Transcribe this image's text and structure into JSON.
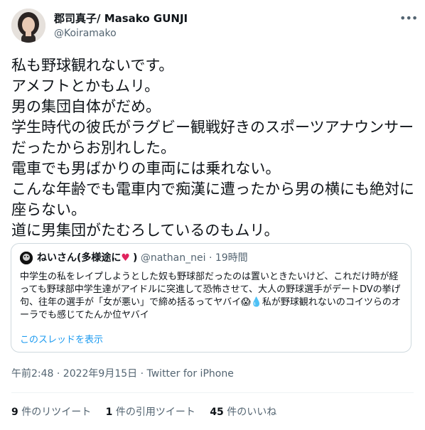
{
  "author": {
    "name": "郡司真子/ Masako GUNJI",
    "handle": "@Koiramako"
  },
  "tweet": {
    "text": "私も野球観れないです。\nアメフトとかもムリ。\n男の集団自体がだめ。\n学生時代の彼氏がラグビー観戦好きのスポーツアナウンサーだったからお別れした。\n電車でも男ばかりの車両には乗れない。\nこんな年齢でも電車内で痴漢に遭ったから男の横にも絶対に座らない。\n道に男集団がたむろしているのもムリ。"
  },
  "quote": {
    "name": "ねいさん(多様途に",
    "heart": "♥",
    "name_suffix": ")",
    "handle": "@nathan_nei",
    "time": "19時間",
    "text": "中学生の私をレイプしようとした奴も野球部だったのは置いときたいけど、これだけ時が経っても野球部中学生達がアイドルに突進して恐怖させて、大人の野球選手がデートDVの挙げ句、往年の選手が「女が悪い」で締め括るってヤバイ😱💧私が野球観れないのコイツらのオーラでも感じてたんか位ヤバイ",
    "thread_link": "このスレッドを表示"
  },
  "meta": {
    "timestamp": "午前2:48 · 2022年9月15日 · Twitter for iPhone"
  },
  "stats": {
    "retweets_count": "9",
    "retweets_label": "件のリツイート",
    "quotes_count": "1",
    "quotes_label": "件の引用ツイート",
    "likes_count": "45",
    "likes_label": "件のいいね"
  },
  "colors": {
    "link": "#1d9bf0",
    "secondary_text": "#536471",
    "border": "#cfd9de",
    "heart": "#e0245e"
  },
  "icons": {
    "more": "more-horizontal-icon"
  }
}
